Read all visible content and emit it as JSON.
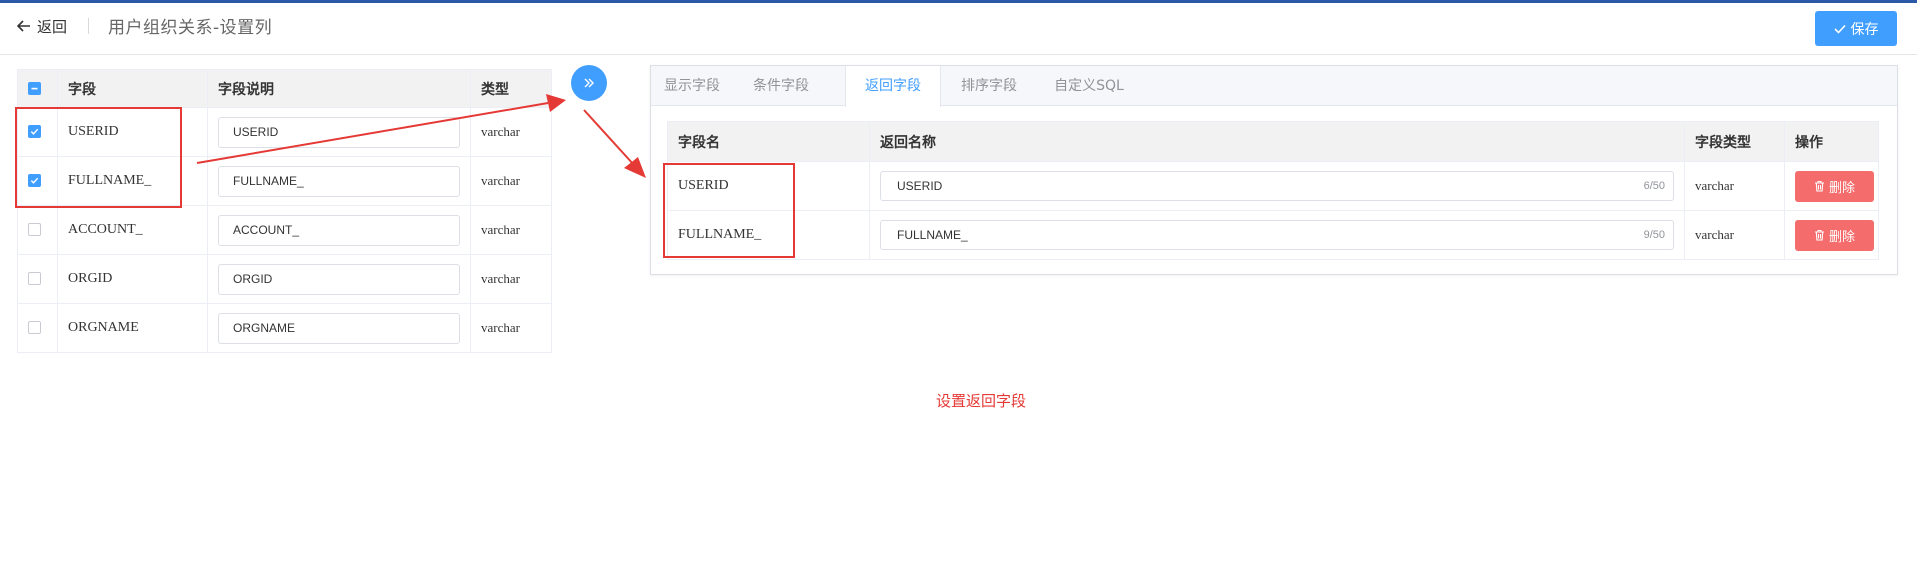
{
  "header": {
    "back_label": "返回",
    "title": "用户组织关系-设置列",
    "save_label": "保存"
  },
  "left_table": {
    "columns": [
      "字段",
      "字段说明",
      "类型"
    ],
    "select_all_state": "partial",
    "rows": [
      {
        "field": "USERID",
        "desc": "USERID",
        "type": "varchar",
        "checked": true
      },
      {
        "field": "FULLNAME_",
        "desc": "FULLNAME_",
        "type": "varchar",
        "checked": true
      },
      {
        "field": "ACCOUNT_",
        "desc": "ACCOUNT_",
        "type": "varchar",
        "checked": false
      },
      {
        "field": "ORGID",
        "desc": "ORGID",
        "type": "varchar",
        "checked": false
      },
      {
        "field": "ORGNAME",
        "desc": "ORGNAME",
        "type": "varchar",
        "checked": false
      }
    ]
  },
  "tabs": [
    "显示字段",
    "条件字段",
    "返回字段",
    "排序字段",
    "自定义SQL"
  ],
  "active_tab": "返回字段",
  "right_table": {
    "columns": [
      "字段名",
      "返回名称",
      "字段类型",
      "操作"
    ],
    "delete_label": "删除",
    "rows": [
      {
        "field": "USERID",
        "return_name": "USERID",
        "counter": "6/50",
        "type": "varchar"
      },
      {
        "field": "FULLNAME_",
        "return_name": "FULLNAME_",
        "counter": "9/50",
        "type": "varchar"
      }
    ]
  },
  "annotation": {
    "caption": "设置返回字段"
  },
  "colors": {
    "primary": "#409eff",
    "danger": "#f56c6c",
    "annotation_red": "#e53935",
    "top_line": "#2b59a8"
  },
  "icons": [
    "arrow-left-icon",
    "check-icon",
    "double-chevron-right-icon",
    "trash-icon"
  ]
}
